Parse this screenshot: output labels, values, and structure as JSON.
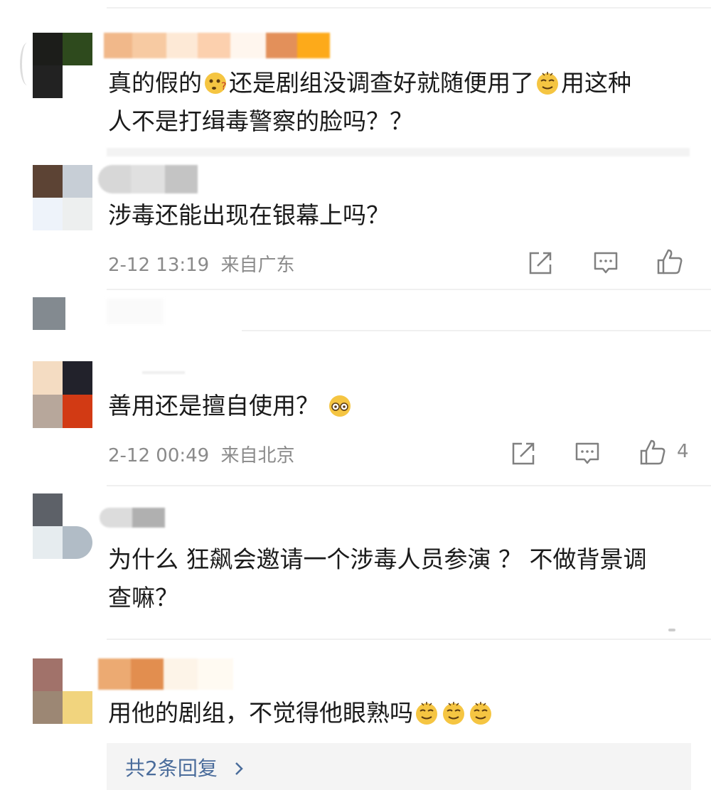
{
  "comments": [
    {
      "text_line1": "真的假的",
      "text_line1b": "还是剧组没调查好就随便用了",
      "text_line1c": "用这种",
      "text_line2": "人不是打缉毒警察的脸吗？？"
    },
    {
      "text": "涉毒还能出现在银幕上吗？",
      "time": "2-12 13:19",
      "location": "来自广东"
    },
    {
      "text": "善用还是擅自使用？",
      "time": "2-12 00:49",
      "location": "来自北京",
      "likes": "4"
    },
    {
      "text_line1": "为什么 狂飙会邀请一个涉毒人员参演 ？ 不做背景调",
      "text_line2": "查嘛？"
    },
    {
      "text": "用他的剧组，不觉得他眼熟吗",
      "replies_label": "共2条回复"
    }
  ],
  "icons": {
    "share": "share-icon",
    "comment": "comment-icon",
    "like": "thumbs-up-icon",
    "chevron": "chevron-right-icon"
  },
  "colors": {
    "text": "#1a1a1a",
    "meta": "#8a8a8a",
    "icon": "#808080",
    "link": "#4a6c9b",
    "emoji": "#f5c542"
  }
}
